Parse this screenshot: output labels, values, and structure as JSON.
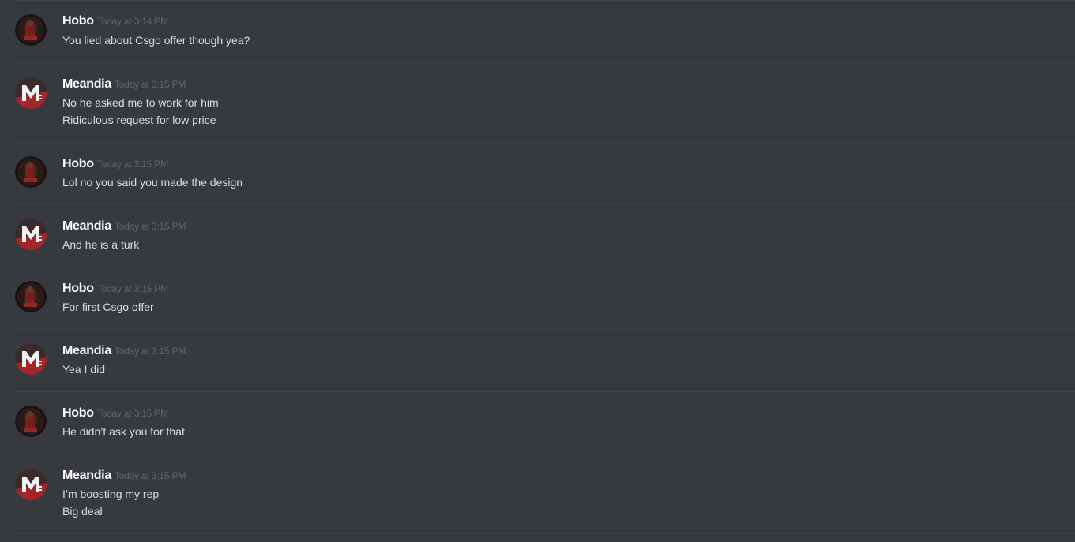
{
  "messages": [
    {
      "author": "Hobo",
      "avatar": "hobo-avatar-icon",
      "time": "Today at 3:14 PM",
      "lines": [
        "You lied about Csgo offer though yea?"
      ]
    },
    {
      "author": "Meandia",
      "avatar": "meandia-avatar-icon",
      "time": "Today at 3:15 PM",
      "lines": [
        "No he asked me to work for him",
        "Ridiculous request for low price"
      ]
    },
    {
      "author": "Hobo",
      "avatar": "hobo-avatar-icon",
      "time": "Today at 3:15 PM",
      "lines": [
        "Lol no you said you made the design"
      ]
    },
    {
      "author": "Meandia",
      "avatar": "meandia-avatar-icon",
      "time": "Today at 3:15 PM",
      "lines": [
        "And he is a turk"
      ]
    },
    {
      "author": "Hobo",
      "avatar": "hobo-avatar-icon",
      "time": "Today at 3:15 PM",
      "lines": [
        "For first Csgo offer"
      ]
    },
    {
      "author": "Meandia",
      "avatar": "meandia-avatar-icon",
      "time": "Today at 3:15 PM",
      "lines": [
        "Yea I did"
      ]
    },
    {
      "author": "Hobo",
      "avatar": "hobo-avatar-icon",
      "time": "Today at 3:15 PM",
      "lines": [
        "He didn’t ask you for that"
      ]
    },
    {
      "author": "Meandia",
      "avatar": "meandia-avatar-icon",
      "time": "Today at 3:15 PM",
      "lines": [
        "I’m boosting my rep",
        "Big deal"
      ]
    }
  ],
  "colors": {
    "background": "#36393e",
    "divider": "#3e4146",
    "username": "#ffffff",
    "timestamp": "#62656a",
    "message_text": "#dcddde"
  }
}
